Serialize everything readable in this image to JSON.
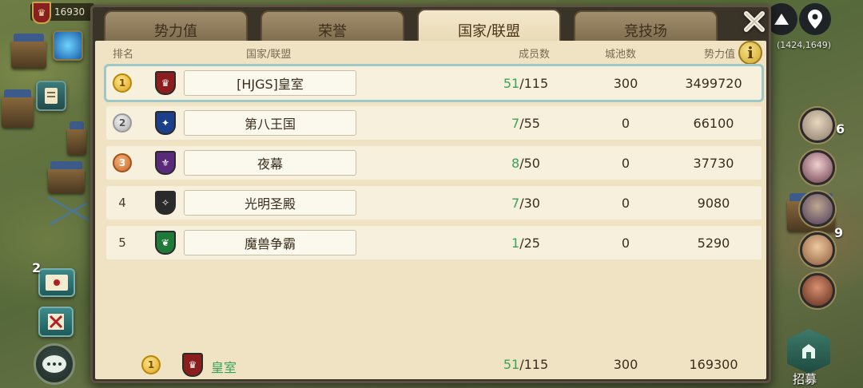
{
  "hud": {
    "resource_value": "16930",
    "coordinates": "(1424,1649)",
    "recruit_label": "招募",
    "hero_counts": [
      "6",
      "9"
    ],
    "left_badge_number": "2"
  },
  "panel": {
    "tabs": [
      {
        "label": "势力值",
        "active": false
      },
      {
        "label": "荣誉",
        "active": false
      },
      {
        "label": "国家/联盟",
        "active": true
      },
      {
        "label": "竞技场",
        "active": false
      }
    ],
    "columns": {
      "rank": "排名",
      "name": "国家/联盟",
      "members": "成员数",
      "cities": "城池数",
      "power": "势力值"
    },
    "info_icon_label": "i",
    "rows": [
      {
        "rank": "1",
        "name": "[HJGS]皇室",
        "members_current": "51",
        "members_max": "/115",
        "cities": "300",
        "power": "3499720",
        "shield_color": "#8c1d1d",
        "shield_icon": "crown-icon"
      },
      {
        "rank": "2",
        "name": "第八王国",
        "members_current": "7",
        "members_max": "/55",
        "cities": "0",
        "power": "66100",
        "shield_color": "#1c3f8c",
        "shield_icon": "eagle-icon"
      },
      {
        "rank": "3",
        "name": "夜幕",
        "members_current": "8",
        "members_max": "/50",
        "cities": "0",
        "power": "37730",
        "shield_color": "#5a2a7a",
        "shield_icon": "fleur-icon"
      },
      {
        "rank": "4",
        "name": "光明圣殿",
        "members_current": "7",
        "members_max": "/30",
        "cities": "0",
        "power": "9080",
        "shield_color": "#2a2a2a",
        "shield_icon": "griffin-icon"
      },
      {
        "rank": "5",
        "name": "魔兽争霸",
        "members_current": "1",
        "members_max": "/25",
        "cities": "0",
        "power": "5290",
        "shield_color": "#1f7a3a",
        "shield_icon": "phoenix-icon"
      }
    ],
    "summary": {
      "rank": "1",
      "name": "皇室",
      "members_current": "51",
      "members_max": "/115",
      "cities": "300",
      "power": "169300"
    }
  },
  "colors": {
    "accent_green": "#3aa35a",
    "panel_bg": "#efe3c3",
    "highlight": "#9ec8c8"
  }
}
